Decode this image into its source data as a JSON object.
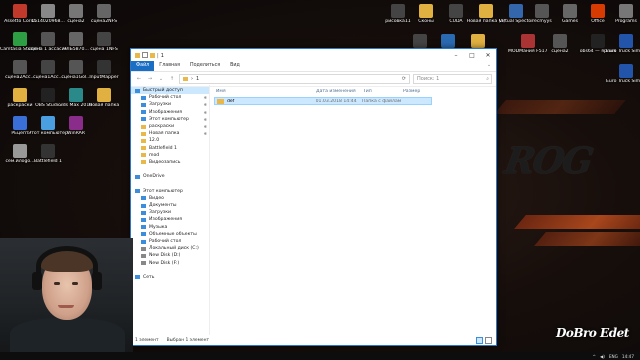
{
  "desktop": {
    "icons_left": [
      {
        "label": "Assetto Corsa",
        "color": "#c0392b"
      },
      {
        "label": "1514020968...",
        "color": "#888888"
      },
      {
        "label": "сцена2",
        "color": "#777777"
      },
      {
        "label": "сцена2NFS",
        "color": "#666666"
      },
      {
        "label": "Camtasia Studio 8",
        "color": "#2e9e45"
      },
      {
        "label": "сцена 1 ассасин",
        "color": "#555555"
      },
      {
        "label": "9ЛЬ5870...",
        "color": "#666666"
      },
      {
        "label": "сцена 1NFS",
        "color": "#444444"
      },
      {
        "label": "сцена2Acc...",
        "color": "#555555"
      },
      {
        "label": "сцена1Асс...",
        "color": "#444444"
      },
      {
        "label": "сцена1Gol...",
        "color": "#555555"
      },
      {
        "label": "InputMapper",
        "color": "#333333"
      },
      {
        "label": "раскраски",
        "color": "#e0b040"
      },
      {
        "label": "OBS Studio",
        "color": "#222222"
      },
      {
        "label": "3ds Max 2016",
        "color": "#2a8a8a"
      },
      {
        "label": "Новая папка",
        "color": "#e0b040"
      },
      {
        "label": "PEцепт",
        "color": "#3a6fd8"
      },
      {
        "label": "Этот компьютер",
        "color": "#4a9fe0"
      },
      {
        "label": "WinRAR",
        "color": "#8a2d8a"
      },
      {
        "label": "сем.йлоgo...",
        "color": "#999999"
      },
      {
        "label": "Battlefield 1",
        "color": "#333333"
      }
    ],
    "icons_right": [
      {
        "label": "рисовка11",
        "color": "#444444"
      },
      {
        "label": "Сконы",
        "color": "#e0b040"
      },
      {
        "label": "CUDA",
        "color": "#444444"
      },
      {
        "label": "Новая папка (3)",
        "color": "#e0b040"
      },
      {
        "label": "Virtual Spector",
        "color": "#3366aa"
      },
      {
        "label": "recmyys",
        "color": "#555555"
      },
      {
        "label": "Games",
        "color": "#666666"
      },
      {
        "label": "Office",
        "color": "#d83b01"
      },
      {
        "label": "Programs",
        "color": "#777777"
      },
      {
        "label": "RT2Studio",
        "color": "#444444"
      },
      {
        "label": "City Car Driving",
        "color": "#2a6ab0"
      },
      {
        "label": "Новая папка (2)",
        "color": "#e0b040"
      },
      {
        "label": "MODМания F517 Z...",
        "color": "#aa3333"
      },
      {
        "label": "сцена2",
        "color": "#555555"
      },
      {
        "label": "obs64 — ярлык",
        "color": "#222222"
      },
      {
        "label": "Euro Truck Simulator 2",
        "color": "#2255aa"
      },
      {
        "label": "Euro Truck Simulator...",
        "color": "#2255aa"
      }
    ]
  },
  "explorer": {
    "path_root": "1",
    "ribbon_tabs": [
      "Файл",
      "Главная",
      "Поделиться",
      "Вид"
    ],
    "search_placeholder": "Поиск: 1",
    "nav": [
      {
        "label": "Быстрый доступ",
        "color": "#3c8ddb",
        "pin": false
      },
      {
        "label": "Рабочий стол",
        "color": "#3c8ddb",
        "pin": true
      },
      {
        "label": "Загрузки",
        "color": "#3c8ddb",
        "pin": true
      },
      {
        "label": "Изображения",
        "color": "#3c8ddb",
        "pin": true
      },
      {
        "label": "Этот компьютер",
        "color": "#3c8ddb",
        "pin": true
      },
      {
        "label": "раскраски",
        "color": "#e8b94a",
        "pin": true
      },
      {
        "label": "Новая папка",
        "color": "#e8b94a",
        "pin": true
      },
      {
        "label": "12.0",
        "color": "#e8b94a",
        "pin": false
      },
      {
        "label": "Battlefield 1",
        "color": "#e8b94a",
        "pin": false
      },
      {
        "label": "mod",
        "color": "#e8b94a",
        "pin": false
      },
      {
        "label": "Видеозапись",
        "color": "#e8b94a",
        "pin": false
      },
      {
        "label": "",
        "color": "",
        "pin": false
      },
      {
        "label": "OneDrive",
        "color": "#3c8ddb",
        "pin": false
      },
      {
        "label": "",
        "color": "",
        "pin": false
      },
      {
        "label": "Этот компьютер",
        "color": "#3c8ddb",
        "pin": false
      },
      {
        "label": "Видео",
        "color": "#3c8ddb",
        "pin": false
      },
      {
        "label": "Документы",
        "color": "#3c8ddb",
        "pin": false
      },
      {
        "label": "Загрузки",
        "color": "#3c8ddb",
        "pin": false
      },
      {
        "label": "Изображения",
        "color": "#3c8ddb",
        "pin": false
      },
      {
        "label": "Музыка",
        "color": "#3c8ddb",
        "pin": false
      },
      {
        "label": "Объемные объекты",
        "color": "#3c8ddb",
        "pin": false
      },
      {
        "label": "Рабочий стол",
        "color": "#3c8ddb",
        "pin": false
      },
      {
        "label": "Локальный диск (C:)",
        "color": "#888888",
        "pin": false
      },
      {
        "label": "New Disk (D:)",
        "color": "#888888",
        "pin": false
      },
      {
        "label": "New Disk (F:)",
        "color": "#888888",
        "pin": false
      },
      {
        "label": "",
        "color": "",
        "pin": false
      },
      {
        "label": "Сеть",
        "color": "#3c8ddb",
        "pin": false
      }
    ],
    "columns": [
      "Имя",
      "Дата изменения",
      "Тип",
      "Размер"
    ],
    "rows": [
      {
        "name": "def",
        "date": "01.03.2018 14:44",
        "type": "Папка с файлами",
        "size": ""
      }
    ],
    "status_count": "1 элемент",
    "status_selected": "Выбран 1 элемент"
  },
  "watermark": "DoBro Edet",
  "taskbar": {
    "lang": "ENG",
    "time": "14:47"
  }
}
